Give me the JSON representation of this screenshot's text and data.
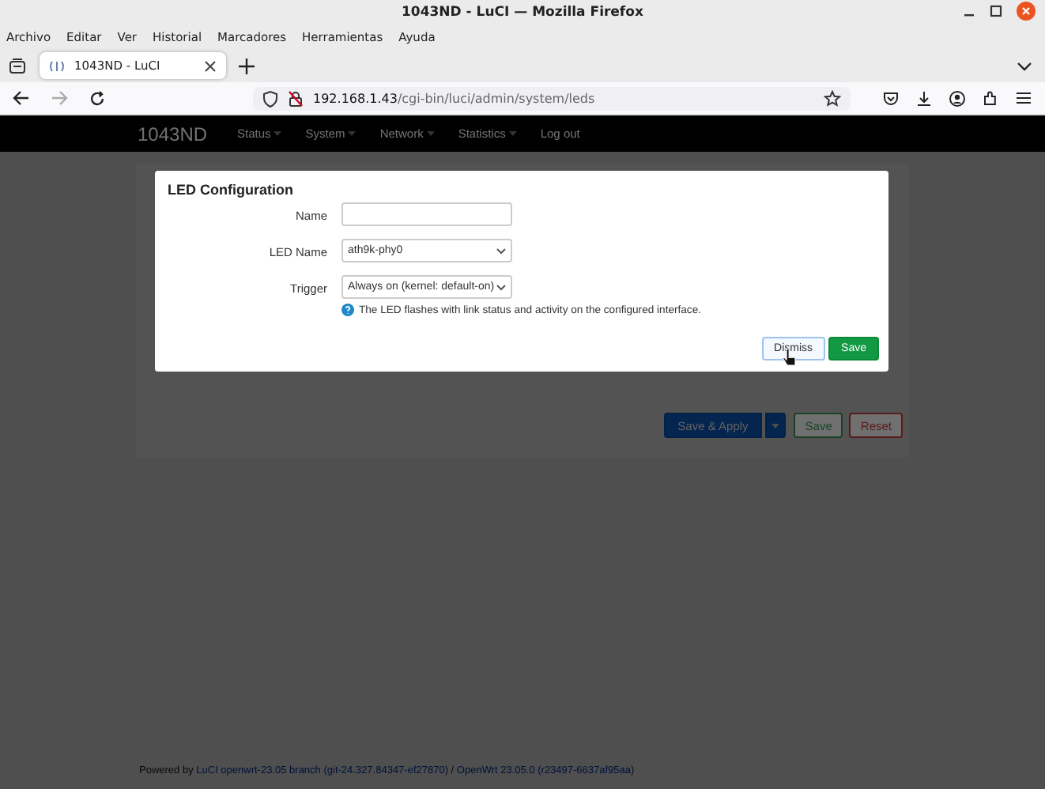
{
  "window": {
    "title": "1043ND - LuCI — Mozilla Firefox"
  },
  "menu": [
    "Archivo",
    "Editar",
    "Ver",
    "Historial",
    "Marcadores",
    "Herramientas",
    "Ayuda"
  ],
  "tabs": [
    {
      "label": "1043ND - LuCI",
      "selected": true
    }
  ],
  "address": {
    "host": "192.168.1.43",
    "path": "/cgi-bin/luci/admin/system/leds"
  },
  "luci": {
    "brand": "1043ND",
    "nav": [
      {
        "label": "Status",
        "dropdown": true
      },
      {
        "label": "System",
        "dropdown": true
      },
      {
        "label": "Network",
        "dropdown": true
      },
      {
        "label": "Statistics",
        "dropdown": true
      },
      {
        "label": "Log out",
        "dropdown": false
      }
    ]
  },
  "page_actions": [
    {
      "label": "Save & Apply",
      "kind": "apply"
    },
    {
      "label": "Save",
      "kind": "save"
    },
    {
      "label": "Reset",
      "kind": "reset"
    }
  ],
  "footer": {
    "prefix": "Powered by",
    "luci_link": "LuCI openwrt-23.05 branch (git-24.327.84347-ef27870)",
    "separator": "/",
    "openwrt_link": "OpenWrt 23.05.0 (r23497-6637af95aa)"
  },
  "dialog": {
    "title": "LED Configuration",
    "fields": [
      {
        "label": "Name",
        "kind": "text"
      },
      {
        "label": "LED Name",
        "kind": "select",
        "value": "ath9k-phy0"
      },
      {
        "label": "Trigger",
        "kind": "select",
        "value": "Always on (kernel: default-on)",
        "help": "The LED flashes with link status and activity on the configured interface."
      }
    ],
    "buttons": [
      {
        "label": "Dismiss",
        "kind": "dismiss"
      },
      {
        "label": "Save",
        "kind": "save"
      }
    ]
  }
}
